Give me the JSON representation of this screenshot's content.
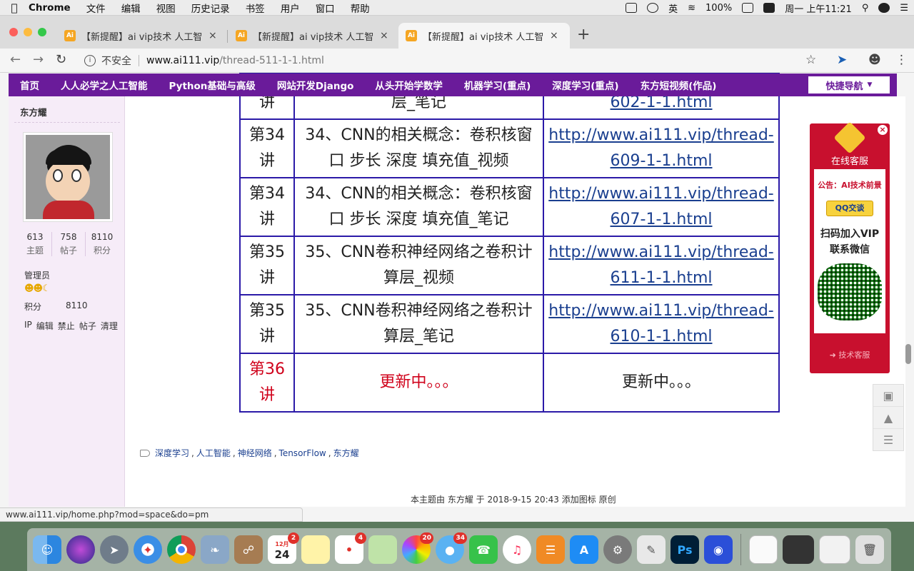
{
  "menubar": {
    "app": "Chrome",
    "items": [
      "文件",
      "编辑",
      "视图",
      "历史记录",
      "书签",
      "用户",
      "窗口",
      "帮助"
    ],
    "input_method": "英",
    "battery": "100%",
    "clock": "周一 上午11:21"
  },
  "tabs": [
    {
      "title": "【新提醒】ai vip技术 人工智能 -",
      "close": "×"
    },
    {
      "title": "【新提醒】ai vip技术 人工智能 -",
      "close": "×"
    },
    {
      "title": "【新提醒】ai vip技术 人工智能 -",
      "close": "×"
    }
  ],
  "toolbar": {
    "security_label": "不安全",
    "url_host": "www.ai111.vip",
    "url_path": "/thread-511-1-1.html"
  },
  "sitenav": {
    "items": [
      "首页",
      "人人必学之人工智能",
      "Python基础与高级",
      "网站开发Django",
      "从头开始学数学",
      "机器学习(重点)",
      "深度学习(重点)",
      "东方短视频(作品)"
    ],
    "quick_nav": "快捷导航"
  },
  "author": {
    "name": "东方耀",
    "stats": [
      {
        "value": "613",
        "label": "主题"
      },
      {
        "value": "758",
        "label": "帖子"
      },
      {
        "value": "8110",
        "label": "积分"
      }
    ],
    "role": "管理员",
    "points_label": "积分",
    "points_value": "8110",
    "actions": [
      "IP",
      "编辑",
      "禁止",
      "帖子",
      "清理"
    ]
  },
  "table": {
    "first_row": {
      "lecture": "讲",
      "title": "层_笔记",
      "link": "602-1-1.html"
    },
    "rows": [
      {
        "lecture": "第34讲",
        "title": "34、CNN的相关概念：卷积核窗口 步长 深度 填充值_视频",
        "link": "http://www.ai111.vip/thread-609-1-1.html"
      },
      {
        "lecture": "第34讲",
        "title": "34、CNN的相关概念：卷积核窗口 步长 深度 填充值_笔记",
        "link": "http://www.ai111.vip/thread-607-1-1.html"
      },
      {
        "lecture": "第35讲",
        "title": "35、CNN卷积神经网络之卷积计算层_视频",
        "link": "http://www.ai111.vip/thread-611-1-1.html"
      },
      {
        "lecture": "第35讲",
        "title": "35、CNN卷积神经网络之卷积计算层_笔记",
        "link": "http://www.ai111.vip/thread-610-1-1.html"
      },
      {
        "lecture": "第36讲",
        "title": "更新中。。。",
        "link": "更新中。。。"
      }
    ]
  },
  "tags": {
    "items": [
      "深度学习",
      "人工智能",
      "神经网络",
      "TensorFlow",
      "东方耀"
    ],
    "separator": ","
  },
  "footer_note": "本主题由 东方耀 于 2018-9-15 20:43 添加图标 原创",
  "ad": {
    "title": "在线客服",
    "marquee": "公告：AI技术前景",
    "qq_button": "QQ交谈",
    "join_line1": "扫码加入VIP",
    "join_line2": "联系微信",
    "bottom": "技术客服"
  },
  "status_url": "www.ai111.vip/home.php?mod=space&do=pm",
  "dock": {
    "calendar_month": "12月",
    "calendar_day": "24",
    "badges": [
      "2",
      "4",
      "20",
      "34"
    ]
  },
  "colors": {
    "nav_purple": "#6a1b9a",
    "table_border": "#2b1aa8",
    "link_blue": "#1a3f8f",
    "update_red": "#d0021b",
    "ad_red": "#c8102e"
  }
}
